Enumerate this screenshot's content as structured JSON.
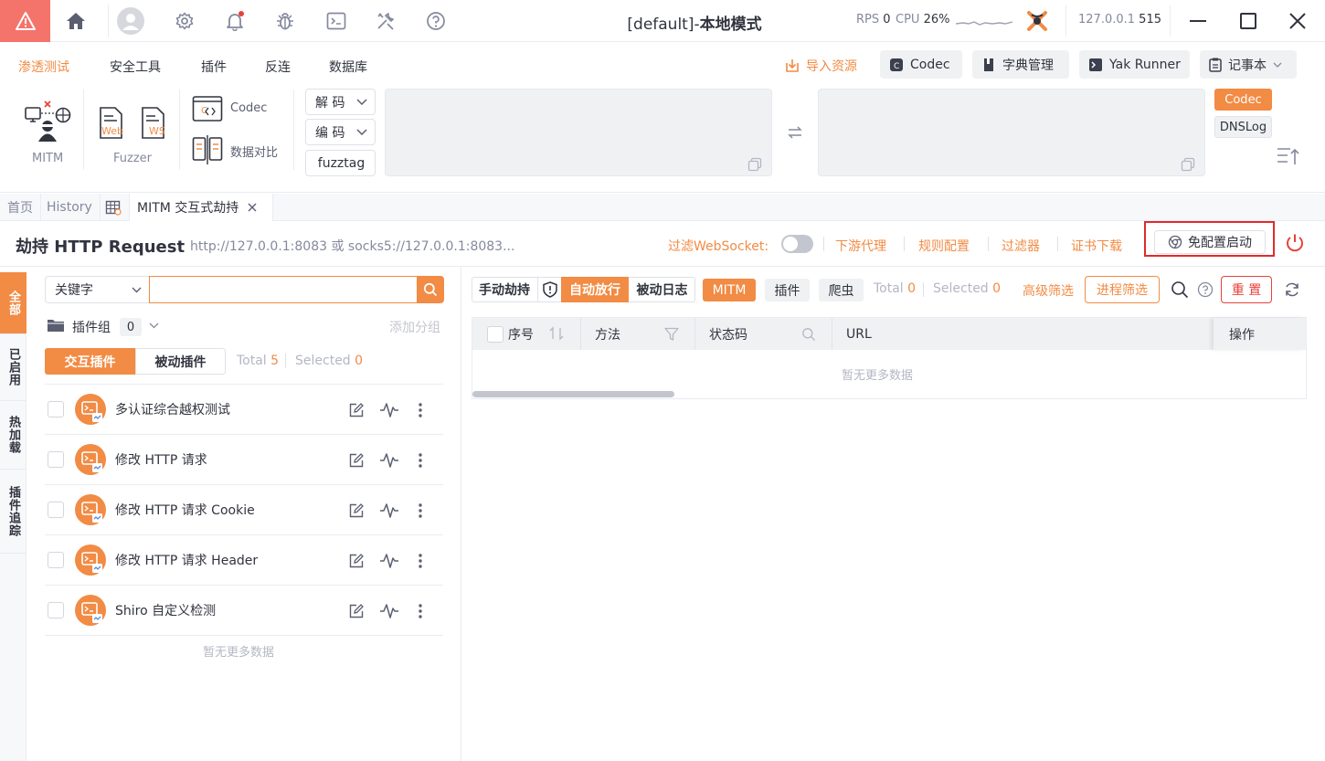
{
  "window": {
    "title_prefix": "[default]-",
    "title_mode": "本地模式",
    "rps_label": "RPS",
    "rps_value": "0",
    "cpu_label": "CPU",
    "cpu_value": "26%",
    "ip": "127.0.0.1",
    "port": "515"
  },
  "menu": {
    "items": [
      "渗透测试",
      "安全工具",
      "插件",
      "反连",
      "数据库"
    ],
    "active": "渗透测试",
    "import_label": "导入资源",
    "codec_label": "Codec",
    "dict_label": "字典管理",
    "runner_label": "Yak Runner",
    "notepad_label": "记事本"
  },
  "ribbon": {
    "mitm_label": "MITM",
    "fuzzer_label": "Fuzzer",
    "web_badge": "Web",
    "ws_badge": "WS",
    "codec_label": "Codec",
    "compare_label": "数据对比",
    "decode_label": "解 码",
    "encode_label": "编 码",
    "fuzztag_label": "fuzztag",
    "side_codec": "Codec",
    "side_dnslog": "DNSLog"
  },
  "tabs": {
    "home": "首页",
    "history": "History",
    "mitm": "MITM 交互式劫持"
  },
  "header": {
    "title": "劫持 HTTP Request",
    "proxy_addr": "http://127.0.0.1:8083 或 socks5://127.0.0.1:8083...",
    "filter_ws": "过滤WebSocket:",
    "downstream": "下游代理",
    "rules": "规则配置",
    "filter": "过滤器",
    "cert": "证书下载",
    "launch": "免配置启动"
  },
  "leftnav": {
    "all": "全部",
    "enabled": "已启用",
    "hotload": "热加载",
    "trace": "插件追踪"
  },
  "plugins": {
    "search_type": "关键字",
    "search_placeholder": "",
    "group_label": "插件组",
    "group_count": "0",
    "add_group": "添加分组",
    "tab_interactive": "交互插件",
    "tab_passive": "被动插件",
    "total_label": "Total",
    "total_value": "5",
    "selected_label": "Selected",
    "selected_value": "0",
    "items": [
      {
        "name": "多认证综合越权测试"
      },
      {
        "name": "修改 HTTP 请求"
      },
      {
        "name": "修改 HTTP 请求 Cookie"
      },
      {
        "name": "修改 HTTP 请求 Header"
      },
      {
        "name": "Shiro 自定义检测"
      }
    ],
    "empty": "暂无更多数据"
  },
  "traffic": {
    "manual": "手动劫持",
    "auto": "自动放行",
    "passive_log": "被动日志",
    "mitm": "MITM",
    "plugin": "插件",
    "crawler": "爬虫",
    "total_label": "Total",
    "total_value": "0",
    "selected_label": "Selected",
    "selected_value": "0",
    "advanced": "高级筛选",
    "process": "进程筛选",
    "reset": "重 置",
    "columns": {
      "seq": "序号",
      "method": "方法",
      "status": "状态码",
      "url": "URL",
      "ops": "操作"
    },
    "empty": "暂无更多数据"
  },
  "colors": {
    "accent": "#f28b44",
    "danger": "#f4736b",
    "highlight_border": "#e02b2b"
  }
}
